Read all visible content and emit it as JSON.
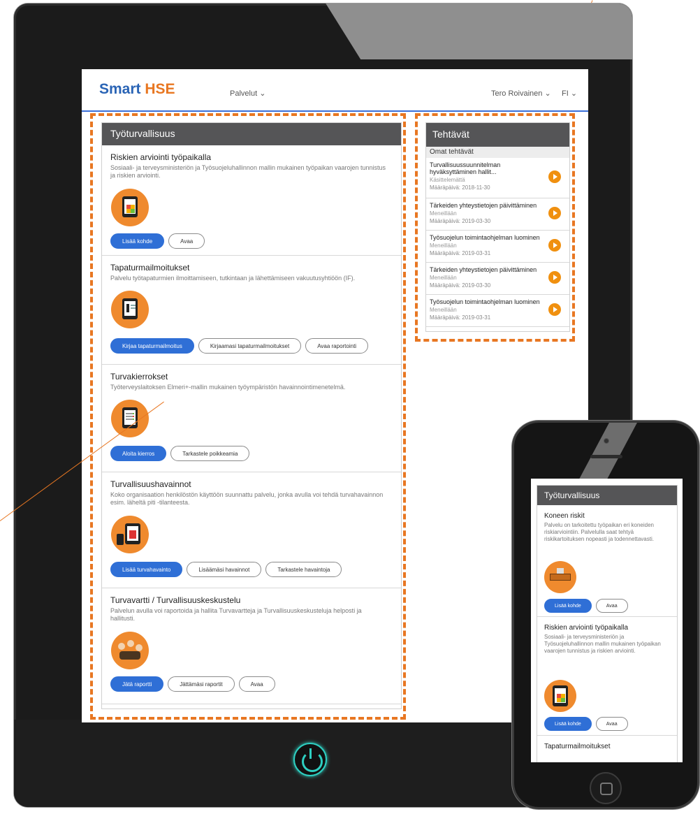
{
  "header": {
    "logo_part1": "Smart",
    "logo_part2": "HSE",
    "services_menu": "Palvelut",
    "user_menu": "Tero Roivainen",
    "language": "FI",
    "chevron": "chevron-down-icon"
  },
  "left_panel": {
    "title": "Työturvallisuus",
    "services": [
      {
        "title": "Riskien arviointi työpaikalla",
        "description": "Sosiaali- ja terveysministeriön ja Työsuojeluhallinnon mallin mukainen työpaikan vaarojen tunnistus ja riskien arviointi.",
        "icon": "risk-matrix-tablet-icon",
        "buttons": [
          "Lisää kohde",
          "Avaa"
        ]
      },
      {
        "title": "Tapaturmailmoitukset",
        "description": "Palvelu työtapaturmien ilmoittamiseen, tutkintaan ja lähettämiseen vakuutusyhtiöön (IF).",
        "icon": "injured-person-report-icon",
        "buttons": [
          "Kirjaa tapaturmailmoitus",
          "Kirjaamasi tapaturmailmoitukset",
          "Avaa raportointi"
        ]
      },
      {
        "title": "Turvakierrokset",
        "description": "Työterveyslaitoksen Elmeri+-mallin mukainen työympäristön havainnointimenetelmä.",
        "icon": "checklist-tablet-icon",
        "buttons": [
          "Aloita kierros",
          "Tarkastele poikkeamia"
        ]
      },
      {
        "title": "Turvallisuushavainnot",
        "description": "Koko organisaation henkilöstön käyttöön suunnattu palvelu, jonka avulla voi tehdä turvahavainnon esim. läheltä piti -tilanteesta.",
        "icon": "safety-observation-icon",
        "buttons": [
          "Lisää turvahavainto",
          "Lisäämäsi havainnot",
          "Tarkastele havaintoja"
        ]
      },
      {
        "title": "Turvavartti / Turvallisuuskeskustelu",
        "description": "Palvelun avulla voi raportoida ja hallita Turvavartteja ja Turvallisuuskeskusteluja helposti ja hallitusti.",
        "icon": "group-discussion-icon",
        "buttons": [
          "Jätä raportti",
          "Jättämäsi raportit",
          "Avaa"
        ]
      }
    ]
  },
  "right_panel": {
    "title": "Tehtävät",
    "subheader": "Omat tehtävät",
    "tasks": [
      {
        "title": "Turvallisuussuunnitelman hyväksyttäminen hallit...",
        "status": "Käsittelemättä",
        "due": "Määräpäivä: 2018-11-30"
      },
      {
        "title": "Tärkeiden yhteystietojen päivittäminen",
        "status": "Meneillään",
        "due": "Määräpäivä: 2019-03-30"
      },
      {
        "title": "Työsuojelun toimintaohjelman luominen",
        "status": "Meneillään",
        "due": "Määräpäivä: 2019-03-31"
      },
      {
        "title": "Tärkeiden yhteystietojen päivittäminen",
        "status": "Meneillään",
        "due": "Määräpäivä: 2019-03-30"
      },
      {
        "title": "Työsuojelun toimintaohjelman luominen",
        "status": "Meneillään",
        "due": "Määräpäivä: 2019-03-31"
      }
    ]
  },
  "phone": {
    "title": "Työturvallisuus",
    "services": [
      {
        "title": "Koneen riskit",
        "description": "Palvelu on tarkoitettu työpaikan eri koneiden riskiarviointiin. Palvelulla saat tehtyä riskikartoituksen nopeasti ja todennettavasti.",
        "icon": "machine-icon",
        "buttons": [
          "Lisää kohde",
          "Avaa"
        ]
      },
      {
        "title": "Riskien arviointi työpaikalla",
        "description": "Sosiaali- ja terveysministeriön ja Työsuojeluhallinnon mallin mukainen työpaikan vaarojen tunnistus ja riskien arviointi.",
        "icon": "risk-matrix-tablet-icon",
        "buttons": [
          "Lisää kohde",
          "Avaa"
        ]
      },
      {
        "title": "Tapaturmailmoitukset",
        "description": "",
        "icon": "injured-person-report-icon",
        "buttons": []
      }
    ]
  },
  "colors": {
    "brand_blue": "#2a64b5",
    "brand_orange": "#e87722",
    "primary_button": "#2f6fd6",
    "panel_header": "#555557",
    "task_arrow": "#f0900f",
    "power_glow": "#2ecfc1"
  }
}
